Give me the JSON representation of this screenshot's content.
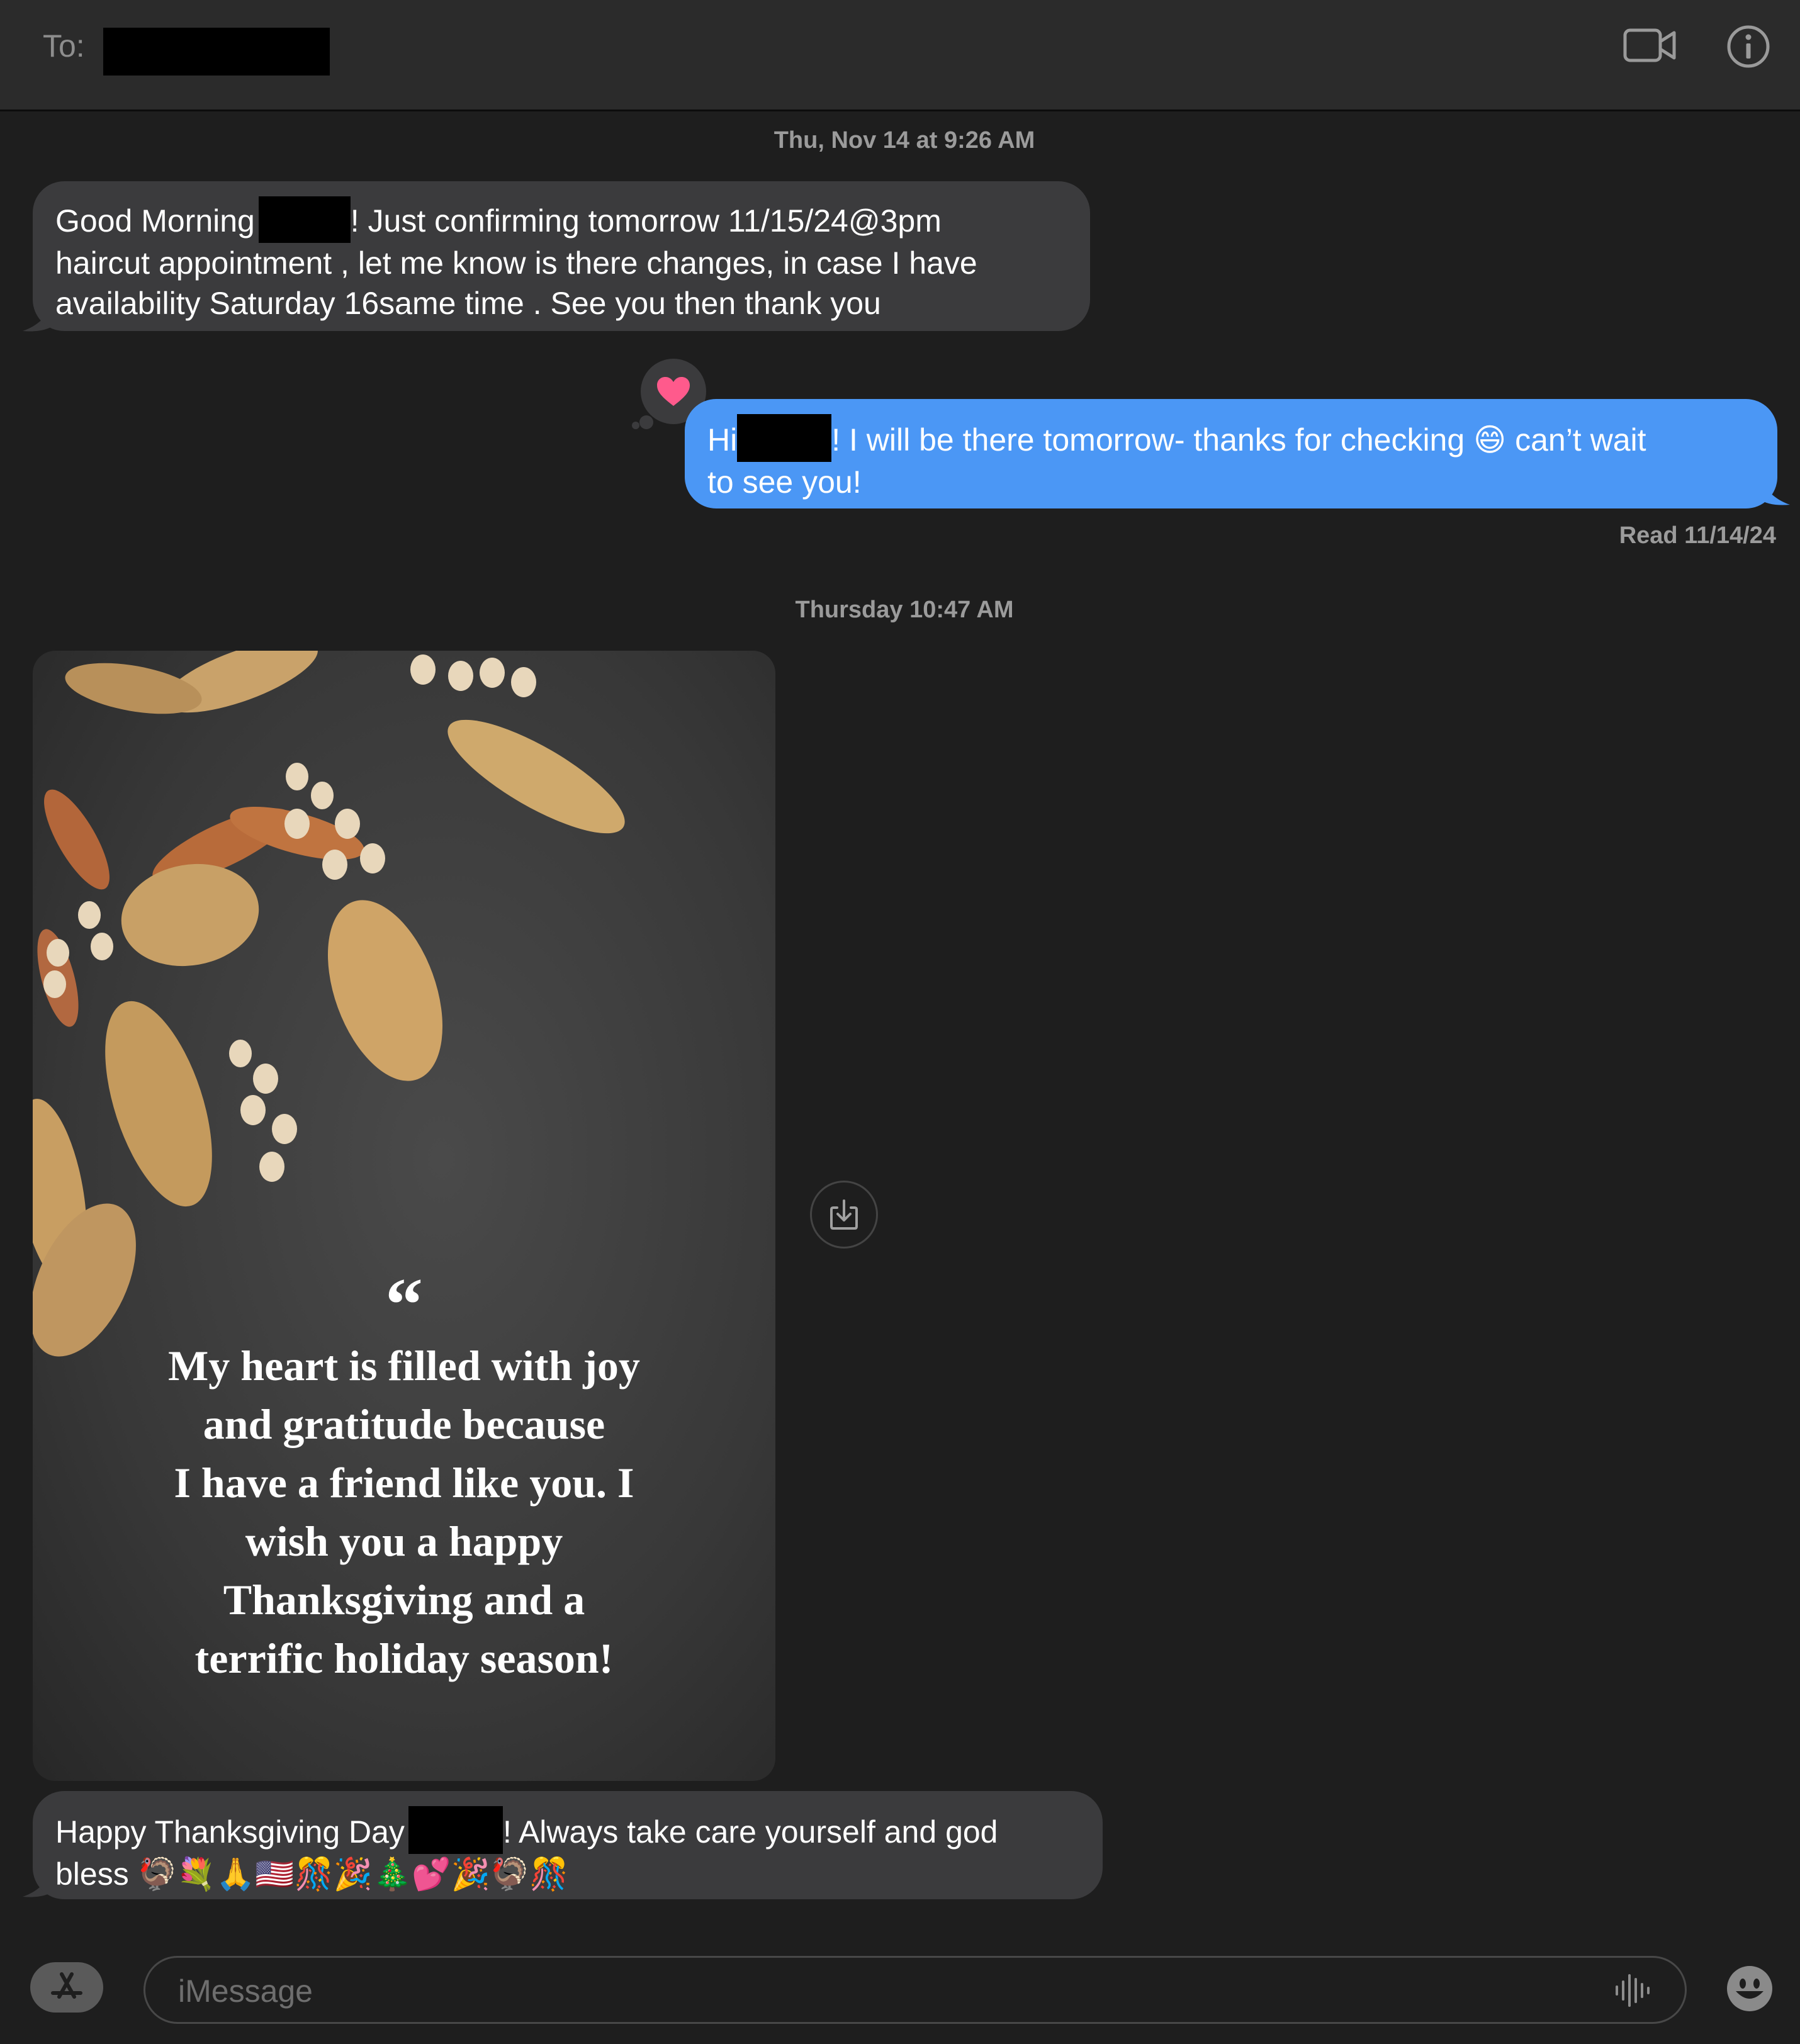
{
  "header": {
    "to_label": "To:",
    "video_icon": "video-camera-icon",
    "info_icon": "info-circle-icon"
  },
  "conversation": {
    "timestamp_1": "Thu, Nov 14 at 9:26 AM",
    "message_1": {
      "part_a": "Good Morning ",
      "part_b": "! Just confirming tomorrow 11/15/24@3pm\nhaircut appointment , let me know is there changes, in case I have\navailability Saturday 16same time . See you then thank you"
    },
    "reaction": "heart-icon",
    "message_2": {
      "part_a": "Hi",
      "part_b": "! I will be there tomorrow- thanks for checking 😄 can’t wait\nto see you!"
    },
    "read_receipt": "Read 11/14/24",
    "timestamp_2": "Thursday 10:47 AM",
    "image": {
      "quote_mark": "“",
      "quote_text": "My heart is filled with joy\nand gratitude because\nI have a friend like you. I\nwish you a happy\nThanksgiving and a\nterrific holiday season!"
    },
    "message_3": {
      "part_a": "Happy Thanksgiving Day",
      "part_b": "! Always take care yourself and god\nbless 🦃💐🙏🇺🇸🎊🎉🎄💕🎉🦃🎊"
    }
  },
  "composer": {
    "placeholder": "iMessage",
    "apps_icon": "app-store-icon",
    "audio_icon": "waveform-icon",
    "emoji_icon": "emoji-icon"
  },
  "colors": {
    "background": "#1e1e1e",
    "received_bubble": "#3b3b3d",
    "sent_bubble": "#4b97f5",
    "reaction_heart": "#ff5a8c"
  }
}
